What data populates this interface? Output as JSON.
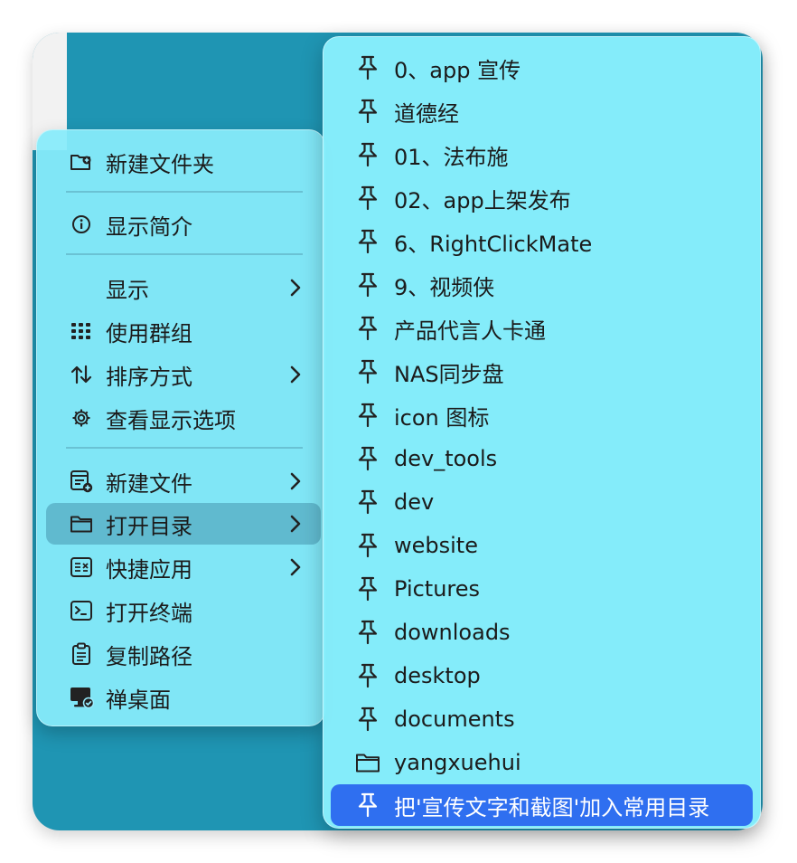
{
  "context_menu": {
    "items": [
      {
        "label": "新建文件夹",
        "icon": "new-folder-icon"
      },
      {
        "label": "显示简介",
        "icon": "info-icon"
      },
      {
        "label": "显示",
        "icon": "",
        "submenu": true
      },
      {
        "label": "使用群组",
        "icon": "grid-icon"
      },
      {
        "label": "排序方式",
        "icon": "sort-arrows-icon",
        "submenu": true
      },
      {
        "label": "查看显示选项",
        "icon": "gear-icon"
      },
      {
        "label": "新建文件",
        "icon": "new-file-icon",
        "submenu": true
      },
      {
        "label": "打开目录",
        "icon": "folder-icon",
        "submenu": true,
        "selected": true
      },
      {
        "label": "快捷应用",
        "icon": "app-shortcut-icon",
        "submenu": true
      },
      {
        "label": "打开终端",
        "icon": "terminal-icon"
      },
      {
        "label": "复制路径",
        "icon": "clipboard-icon"
      },
      {
        "label": "禅桌面",
        "icon": "desktop-check-icon"
      }
    ]
  },
  "submenu": {
    "items": [
      {
        "label": "0、app 宣传",
        "icon": "pin-icon"
      },
      {
        "label": "道德经",
        "icon": "pin-icon"
      },
      {
        "label": "01、法布施",
        "icon": "pin-icon"
      },
      {
        "label": "02、app上架发布",
        "icon": "pin-icon"
      },
      {
        "label": "6、RightClickMate",
        "icon": "pin-icon"
      },
      {
        "label": "9、视频侠",
        "icon": "pin-icon"
      },
      {
        "label": "产品代言人卡通",
        "icon": "pin-icon"
      },
      {
        "label": "NAS同步盘",
        "icon": "pin-icon"
      },
      {
        "label": "icon 图标",
        "icon": "pin-icon"
      },
      {
        "label": "dev_tools",
        "icon": "pin-icon"
      },
      {
        "label": "dev",
        "icon": "pin-icon"
      },
      {
        "label": "website",
        "icon": "pin-icon"
      },
      {
        "label": "Pictures",
        "icon": "pin-icon"
      },
      {
        "label": "downloads",
        "icon": "pin-icon"
      },
      {
        "label": "desktop",
        "icon": "pin-icon"
      },
      {
        "label": "documents",
        "icon": "pin-icon"
      },
      {
        "label": "yangxuehui",
        "icon": "folder-icon"
      },
      {
        "label": "把'宣传文字和截图'加入常用目录",
        "icon": "pin-icon",
        "highlighted": true
      }
    ]
  },
  "colors": {
    "desktop": "#1f95b3",
    "menu_bg": "#87ebfa",
    "highlight": "#2f6ff0"
  }
}
